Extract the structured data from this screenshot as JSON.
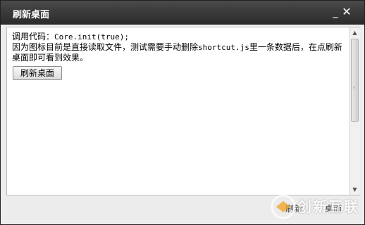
{
  "window": {
    "title": "刷新桌面",
    "minimize_symbol": "_",
    "close_symbol": "✕"
  },
  "content": {
    "line1_prefix": "调用代码：",
    "line1_code": "Core.init(true);",
    "line2": "因为图标目前是直接读取文件，测试需要手动删除",
    "line2_code": "shortcut.js",
    "line2_suffix": "里一条数据后，在点刷新桌面即可看到效果。",
    "button_label": "刷新桌面"
  },
  "footer": {
    "button1": "刷新",
    "button2": "桌面"
  },
  "watermark": {
    "text": "创新互联"
  },
  "colors": {
    "titlebar": "#333333",
    "desktop": "#6e3b9e",
    "content_bg": "#ffffff"
  }
}
